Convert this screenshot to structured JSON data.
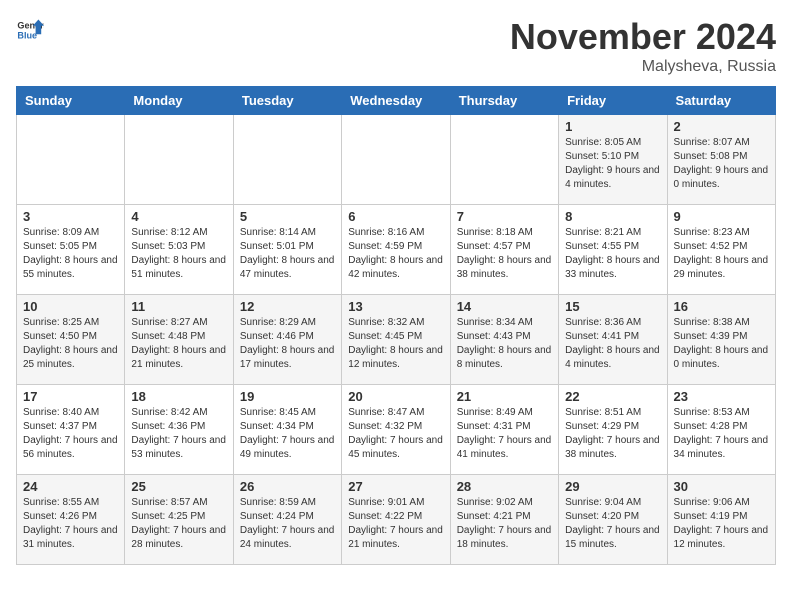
{
  "header": {
    "logo_general": "General",
    "logo_blue": "Blue",
    "month_title": "November 2024",
    "location": "Malysheva, Russia"
  },
  "weekdays": [
    "Sunday",
    "Monday",
    "Tuesday",
    "Wednesday",
    "Thursday",
    "Friday",
    "Saturday"
  ],
  "weeks": [
    [
      {
        "day": "",
        "info": ""
      },
      {
        "day": "",
        "info": ""
      },
      {
        "day": "",
        "info": ""
      },
      {
        "day": "",
        "info": ""
      },
      {
        "day": "",
        "info": ""
      },
      {
        "day": "1",
        "info": "Sunrise: 8:05 AM\nSunset: 5:10 PM\nDaylight: 9 hours and 4 minutes."
      },
      {
        "day": "2",
        "info": "Sunrise: 8:07 AM\nSunset: 5:08 PM\nDaylight: 9 hours and 0 minutes."
      }
    ],
    [
      {
        "day": "3",
        "info": "Sunrise: 8:09 AM\nSunset: 5:05 PM\nDaylight: 8 hours and 55 minutes."
      },
      {
        "day": "4",
        "info": "Sunrise: 8:12 AM\nSunset: 5:03 PM\nDaylight: 8 hours and 51 minutes."
      },
      {
        "day": "5",
        "info": "Sunrise: 8:14 AM\nSunset: 5:01 PM\nDaylight: 8 hours and 47 minutes."
      },
      {
        "day": "6",
        "info": "Sunrise: 8:16 AM\nSunset: 4:59 PM\nDaylight: 8 hours and 42 minutes."
      },
      {
        "day": "7",
        "info": "Sunrise: 8:18 AM\nSunset: 4:57 PM\nDaylight: 8 hours and 38 minutes."
      },
      {
        "day": "8",
        "info": "Sunrise: 8:21 AM\nSunset: 4:55 PM\nDaylight: 8 hours and 33 minutes."
      },
      {
        "day": "9",
        "info": "Sunrise: 8:23 AM\nSunset: 4:52 PM\nDaylight: 8 hours and 29 minutes."
      }
    ],
    [
      {
        "day": "10",
        "info": "Sunrise: 8:25 AM\nSunset: 4:50 PM\nDaylight: 8 hours and 25 minutes."
      },
      {
        "day": "11",
        "info": "Sunrise: 8:27 AM\nSunset: 4:48 PM\nDaylight: 8 hours and 21 minutes."
      },
      {
        "day": "12",
        "info": "Sunrise: 8:29 AM\nSunset: 4:46 PM\nDaylight: 8 hours and 17 minutes."
      },
      {
        "day": "13",
        "info": "Sunrise: 8:32 AM\nSunset: 4:45 PM\nDaylight: 8 hours and 12 minutes."
      },
      {
        "day": "14",
        "info": "Sunrise: 8:34 AM\nSunset: 4:43 PM\nDaylight: 8 hours and 8 minutes."
      },
      {
        "day": "15",
        "info": "Sunrise: 8:36 AM\nSunset: 4:41 PM\nDaylight: 8 hours and 4 minutes."
      },
      {
        "day": "16",
        "info": "Sunrise: 8:38 AM\nSunset: 4:39 PM\nDaylight: 8 hours and 0 minutes."
      }
    ],
    [
      {
        "day": "17",
        "info": "Sunrise: 8:40 AM\nSunset: 4:37 PM\nDaylight: 7 hours and 56 minutes."
      },
      {
        "day": "18",
        "info": "Sunrise: 8:42 AM\nSunset: 4:36 PM\nDaylight: 7 hours and 53 minutes."
      },
      {
        "day": "19",
        "info": "Sunrise: 8:45 AM\nSunset: 4:34 PM\nDaylight: 7 hours and 49 minutes."
      },
      {
        "day": "20",
        "info": "Sunrise: 8:47 AM\nSunset: 4:32 PM\nDaylight: 7 hours and 45 minutes."
      },
      {
        "day": "21",
        "info": "Sunrise: 8:49 AM\nSunset: 4:31 PM\nDaylight: 7 hours and 41 minutes."
      },
      {
        "day": "22",
        "info": "Sunrise: 8:51 AM\nSunset: 4:29 PM\nDaylight: 7 hours and 38 minutes."
      },
      {
        "day": "23",
        "info": "Sunrise: 8:53 AM\nSunset: 4:28 PM\nDaylight: 7 hours and 34 minutes."
      }
    ],
    [
      {
        "day": "24",
        "info": "Sunrise: 8:55 AM\nSunset: 4:26 PM\nDaylight: 7 hours and 31 minutes."
      },
      {
        "day": "25",
        "info": "Sunrise: 8:57 AM\nSunset: 4:25 PM\nDaylight: 7 hours and 28 minutes."
      },
      {
        "day": "26",
        "info": "Sunrise: 8:59 AM\nSunset: 4:24 PM\nDaylight: 7 hours and 24 minutes."
      },
      {
        "day": "27",
        "info": "Sunrise: 9:01 AM\nSunset: 4:22 PM\nDaylight: 7 hours and 21 minutes."
      },
      {
        "day": "28",
        "info": "Sunrise: 9:02 AM\nSunset: 4:21 PM\nDaylight: 7 hours and 18 minutes."
      },
      {
        "day": "29",
        "info": "Sunrise: 9:04 AM\nSunset: 4:20 PM\nDaylight: 7 hours and 15 minutes."
      },
      {
        "day": "30",
        "info": "Sunrise: 9:06 AM\nSunset: 4:19 PM\nDaylight: 7 hours and 12 minutes."
      }
    ]
  ]
}
